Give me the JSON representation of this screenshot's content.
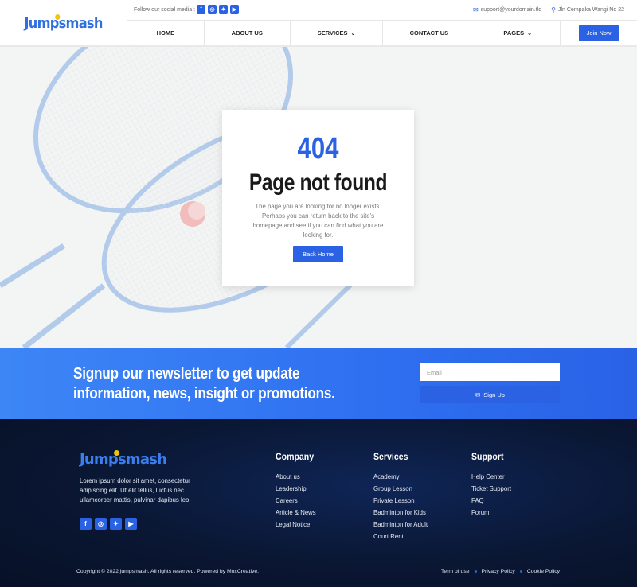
{
  "brand": {
    "logo": "Jumpsmash"
  },
  "topbar": {
    "follow_label": "Follow our social media :",
    "email": "support@yourdomain.tld",
    "address": "Jln Cempaka Wangi No 22"
  },
  "social_icons": [
    "facebook-icon",
    "instagram-icon",
    "twitter-icon",
    "youtube-icon"
  ],
  "nav": {
    "items": [
      {
        "label": "HOME",
        "has_dropdown": false
      },
      {
        "label": "ABOUT US",
        "has_dropdown": false
      },
      {
        "label": "SERVICES",
        "has_dropdown": true
      },
      {
        "label": "CONTACT US",
        "has_dropdown": false
      },
      {
        "label": "PAGES",
        "has_dropdown": true
      }
    ],
    "cta": "Join Now"
  },
  "error": {
    "code": "404",
    "title": "Page not found",
    "message": "The page you are looking for no longer exists. Perhaps you can return back to the site's homepage and see if you can find what you are looking for.",
    "button": "Back Home"
  },
  "newsletter": {
    "title": "Signup our newsletter to get update information, news, insight or promotions.",
    "email_placeholder": "Email",
    "button": "Sign Up"
  },
  "footer": {
    "about": "Lorem ipsum dolor sit amet, consectetur adipiscing elit. Ut elit tellus, luctus nec ullamcorper mattis, pulvinar dapibus leo.",
    "columns": [
      {
        "title": "Company",
        "links": [
          "About us",
          "Leadership",
          "Careers",
          "Article & News",
          "Legal Notice"
        ]
      },
      {
        "title": "Services",
        "links": [
          "Academy",
          "Group Lesson",
          "Private Lesson",
          "Badminton for Kids",
          "Badminton for Adult",
          "Court Rent"
        ]
      },
      {
        "title": "Support",
        "links": [
          "Help Center",
          "Ticket Support",
          "FAQ",
          "Forum"
        ]
      }
    ],
    "copyright": "Copyright © 2022 jumpsmash, All rights reserved. Powered by MoxCreative.",
    "legal_links": [
      "Term of use",
      "Privacy Policy",
      "Cookie Policy"
    ]
  },
  "colors": {
    "primary": "#2b62e3",
    "footer_bg": "#0a1733",
    "accent_dot": "#f1c40f"
  }
}
